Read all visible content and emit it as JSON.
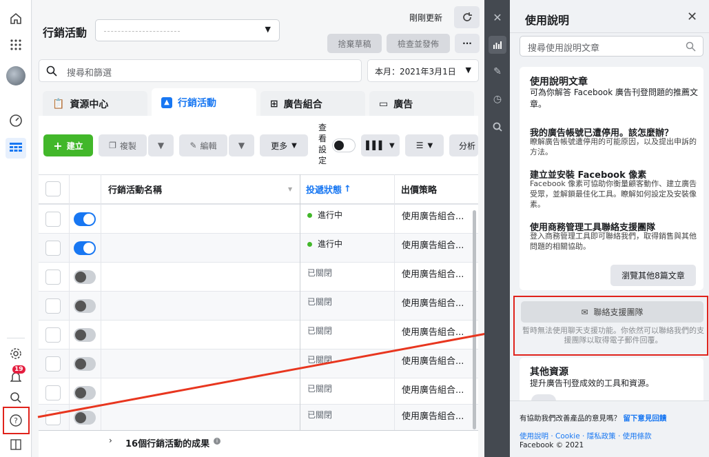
{
  "rail": {
    "notification_count": "19"
  },
  "header": {
    "title": "行銷活動",
    "last_updated": "剛剛更新",
    "discard_draft": "捨棄草稿",
    "review_publish": "檢查並發佈",
    "more_dots": "···"
  },
  "search": {
    "placeholder": "搜尋和篩選"
  },
  "date_range": {
    "label": "本月：2021年3月1日"
  },
  "tabs": [
    {
      "label": "資源中心"
    },
    {
      "label": "行銷活動"
    },
    {
      "label": "廣告組合"
    },
    {
      "label": "廣告"
    }
  ],
  "toolbar": {
    "create": "建立",
    "copy": "複製",
    "edit": "編輯",
    "more": "更多",
    "view_settings": [
      "查",
      "看",
      "設",
      "定"
    ],
    "analyze": "分析"
  },
  "table": {
    "columns": {
      "name": "行銷活動名稱",
      "delivery": "投遞狀態",
      "bid": "出價策略"
    },
    "rows": [
      {
        "delivery": "進行中",
        "bid": "使用廣告組合..."
      },
      {
        "delivery": "進行中",
        "bid": "使用廣告組合..."
      },
      {
        "delivery": "已關閉",
        "bid": "使用廣告組合..."
      },
      {
        "delivery": "已關閉",
        "bid": "使用廣告組合..."
      },
      {
        "delivery": "已關閉",
        "bid": "使用廣告組合..."
      },
      {
        "delivery": "已關閉",
        "bid": "使用廣告組合..."
      },
      {
        "delivery": "已關閉",
        "bid": "使用廣告組合..."
      },
      {
        "delivery": "已關閉",
        "bid": "使用廣告組合..."
      }
    ],
    "footer": "16個行銷活動的成果"
  },
  "help": {
    "title": "使用說明",
    "search_placeholder": "搜尋使用說明文章",
    "articles_title": "使用說明文章",
    "articles_sub": "可為你解答 Facebook 廣告刊登問題的推薦文章。",
    "articles": [
      {
        "title": "我的廣告帳號已遭停用。該怎麼辦？",
        "text": "瞭解廣告帳號遭停用的可能原因，以及提出申訴的方法。"
      },
      {
        "title": "建立並安裝 Facebook 像素",
        "text": "Facebook 像素可協助你衡量顧客動作、建立廣告受眾，並解鎖最佳化工具。瞭解如何設定及安裝像素。"
      },
      {
        "title": "使用商務管理工具聯絡支援團隊",
        "text": "登入商務管理工具即可聯絡我們，取得銷售與其他問題的相關協助。"
      }
    ],
    "browse_more": "瀏覽其他8篇文章",
    "contact_button": "聯絡支援團隊",
    "contact_note": "暫時無法使用聊天支援功能。你依然可以聯絡我們的支援團隊以取得電子郵件回覆。",
    "other_title": "其他資源",
    "other_sub": "提升廣告刊登成效的工具和資源。",
    "feedback_q": "有協助我們改善產品的意見嗎？",
    "feedback_link": "留下意見回饋",
    "footer_links": "使用說明 · Cookie · 隱私政策 · 使用條款",
    "copyright": "Facebook © 2021"
  }
}
